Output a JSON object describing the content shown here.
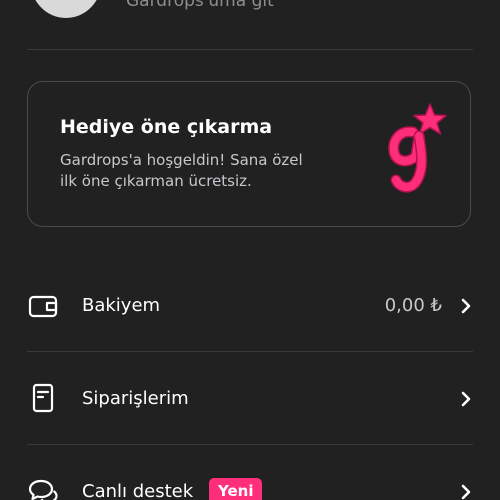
{
  "profile": {
    "link_text": "Gardrops'uma git"
  },
  "promo": {
    "title": "Hediye öne çıkarma",
    "description": "Gardrops'a hoşgeldin! Sana özel ilk öne çıkarman ücretsiz.",
    "logo_icon": "gardrops-g-star-logo",
    "accent_color": "#ff2e7a"
  },
  "menu": {
    "wallet": {
      "label": "Bakiyem",
      "value": "0,00 ₺",
      "icon": "wallet-icon"
    },
    "orders": {
      "label": "Siparişlerim",
      "icon": "receipt-icon"
    },
    "support": {
      "label": "Canlı destek",
      "badge": "Yeni",
      "icon": "chat-bubbles-icon"
    }
  },
  "colors": {
    "background": "#212121",
    "badge": "#ff2e7a"
  }
}
